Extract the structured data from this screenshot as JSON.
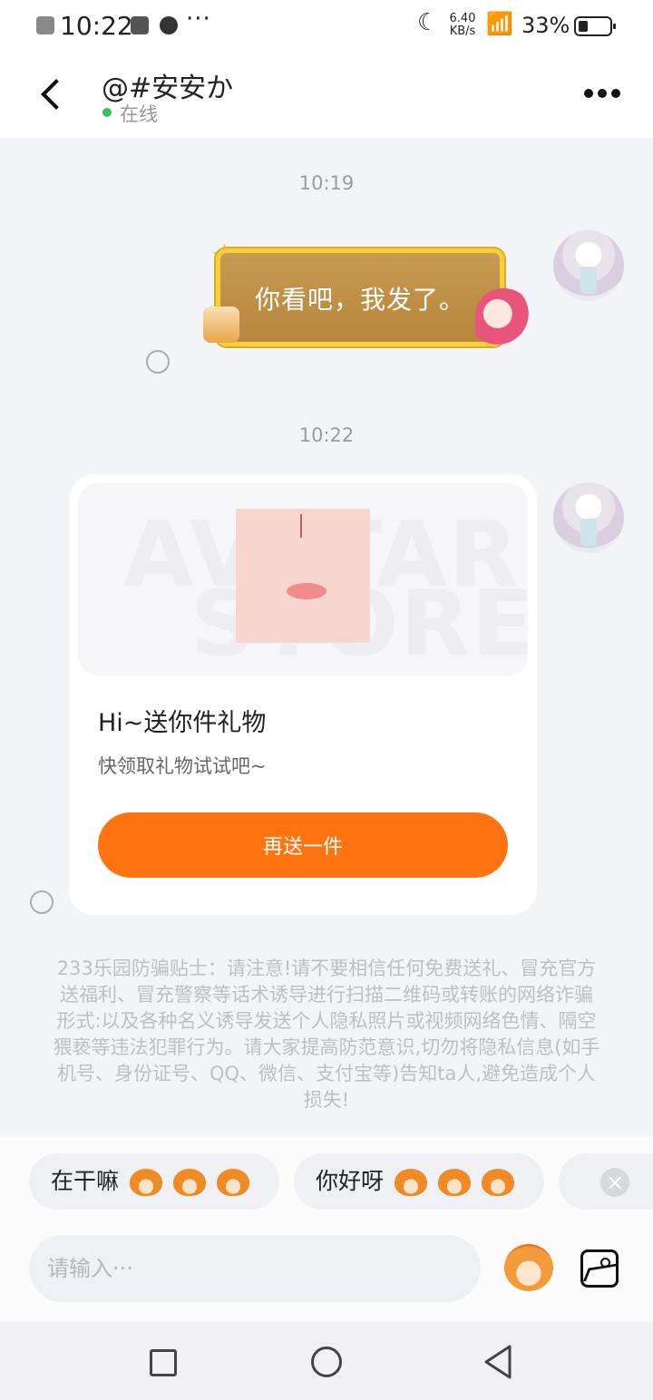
{
  "status_bar": {
    "time": "10:22",
    "dots": "···",
    "speed_value": "6.40",
    "speed_unit": "KB/s",
    "battery": "33%"
  },
  "header": {
    "title": "@#安安か",
    "status": "在线"
  },
  "chat": {
    "messages": [
      {
        "timestamp": "10:19",
        "text": "你看吧，我发了。"
      },
      {
        "timestamp": "10:22",
        "gift_title": "Hi~送你件礼物",
        "gift_subtitle": "快领取礼物试试吧~",
        "gift_button": "再送一件",
        "watermark_top": "AVATAR",
        "watermark_bottom": "STORE"
      }
    ],
    "tips": "233乐园防骗贴士：请注意!请不要相信任何免费送礼、冒充官方送福利、冒充警察等话术诱导进行扫描二维码或转账的网络诈骗形式:以及各种名义诱导发送个人隐私照片或视频网络色情、隔空猥亵等违法犯罪行为。请大家提高防范意识,切勿将隐私信息(如手机号、身份证号、QQ、微信、支付宝等)告知ta人,避免造成个人损失!"
  },
  "quick_replies": [
    {
      "label": "在干嘛"
    },
    {
      "label": "你好呀"
    }
  ],
  "input": {
    "placeholder": "请输入···"
  },
  "colors": {
    "accent": "#ff7411",
    "online": "#2dc65a",
    "gold": "#f3d03c"
  },
  "icons": [
    "back-arrow-icon",
    "more-icon",
    "close-icon",
    "emoji-mascot-icon",
    "image-icon"
  ]
}
